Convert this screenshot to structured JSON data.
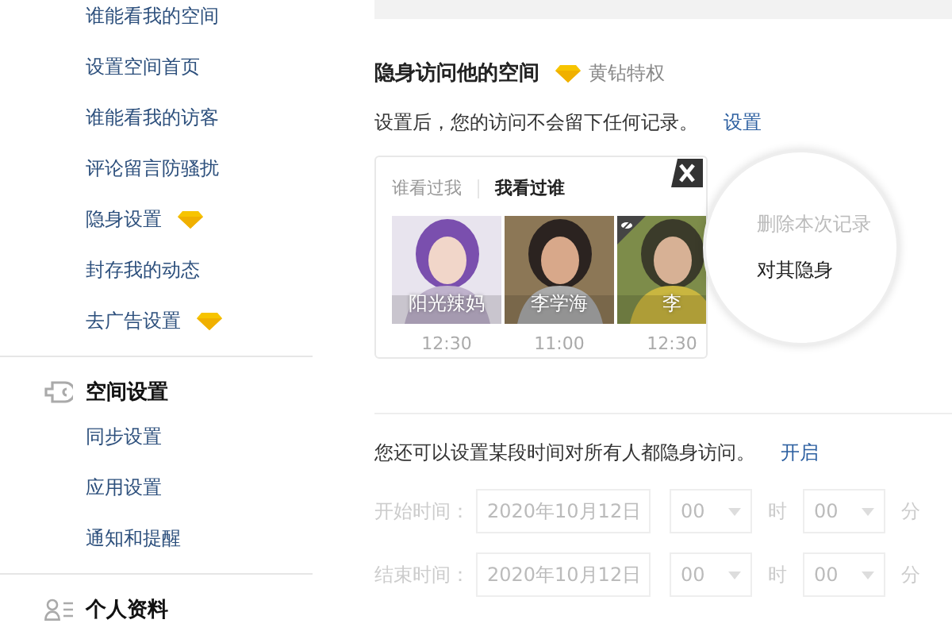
{
  "sidebar": {
    "sections": [
      {
        "items": [
          {
            "label": "谁能看我的空间",
            "vip": false
          },
          {
            "label": "设置空间首页",
            "vip": false
          },
          {
            "label": "谁能看我的访客",
            "vip": false
          },
          {
            "label": "评论留言防骚扰",
            "vip": false
          },
          {
            "label": "隐身设置",
            "vip": true
          },
          {
            "label": "封存我的动态",
            "vip": false
          },
          {
            "label": "去广告设置",
            "vip": true
          }
        ]
      },
      {
        "title": "空间设置",
        "kind": "settings",
        "items": [
          {
            "label": "同步设置",
            "vip": false
          },
          {
            "label": "应用设置",
            "vip": false
          },
          {
            "label": "通知和提醒",
            "vip": false
          }
        ]
      },
      {
        "title": "个人资料",
        "kind": "profile"
      }
    ]
  },
  "main": {
    "title": "隐身访问他的空间",
    "badge": "黄钻特权",
    "description": "设置后，您的访问不会留下任何记录。",
    "description_link": "设置",
    "preview": {
      "tabs": [
        {
          "label": "谁看过我",
          "selected": false
        },
        {
          "label": "我看过谁",
          "selected": true
        }
      ],
      "visitors": [
        {
          "name": "阳光辣妈",
          "time": "12:30",
          "hidden": false
        },
        {
          "name": "李学海",
          "time": "11:00",
          "hidden": false
        },
        {
          "name": "李",
          "time": "12:30",
          "hidden": true
        }
      ],
      "menu": [
        {
          "label": "删除本次记录",
          "disabled": true
        },
        {
          "label": "对其隐身",
          "disabled": false
        }
      ]
    },
    "schedule": {
      "text": "您还可以设置某段时间对所有人都隐身访问。",
      "link": "开启",
      "disabled": true,
      "rows": [
        {
          "label": "开始时间：",
          "date": "2020年10月12日",
          "hour": "00",
          "hour_unit": "时",
          "minute": "00",
          "minute_unit": "分"
        },
        {
          "label": "结束时间：",
          "date": "2020年10月12日",
          "hour": "00",
          "hour_unit": "时",
          "minute": "00",
          "minute_unit": "分"
        }
      ]
    }
  }
}
